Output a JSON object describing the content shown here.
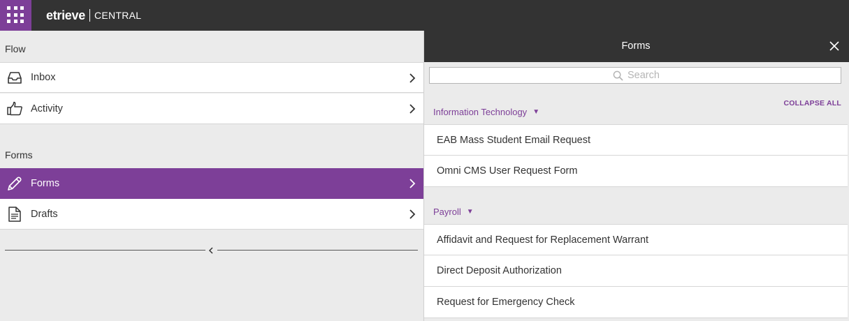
{
  "app": {
    "brand_name": "etrieve",
    "brand_sub": "CENTRAL"
  },
  "colors": {
    "accent": "#7d3f98",
    "header_bg": "#333333",
    "panel_bg": "#ebebeb"
  },
  "left": {
    "flow_label": "Flow",
    "flow_items": [
      {
        "label": "Inbox",
        "icon": "inbox-icon"
      },
      {
        "label": "Activity",
        "icon": "thumbs-up-icon"
      }
    ],
    "forms_label": "Forms",
    "forms_items": [
      {
        "label": "Forms",
        "icon": "pencil-icon",
        "active": true
      },
      {
        "label": "Drafts",
        "icon": "document-icon",
        "active": false
      }
    ]
  },
  "right": {
    "title": "Forms",
    "search_placeholder": "Search",
    "collapse_all": "COLLAPSE ALL",
    "groups": [
      {
        "name": "Information Technology",
        "items": [
          "EAB Mass Student Email Request",
          "Omni CMS User Request Form"
        ]
      },
      {
        "name": "Payroll",
        "items": [
          "Affidavit and Request for Replacement Warrant",
          "Direct Deposit Authorization",
          "Request for Emergency Check"
        ]
      }
    ]
  }
}
